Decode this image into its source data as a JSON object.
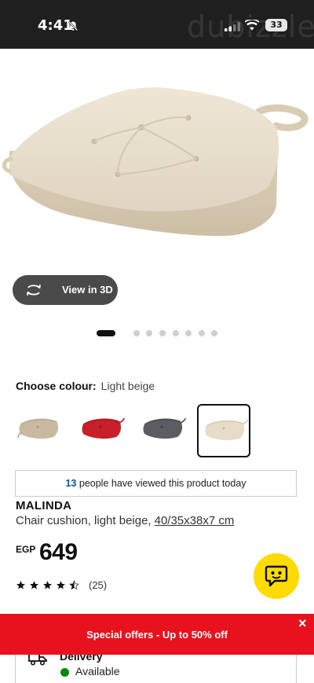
{
  "status_bar": {
    "time": "4:41",
    "battery": "33",
    "watermark": "dubizzle"
  },
  "product_gallery": {
    "view3d_label": "View in 3D",
    "image_count": 9,
    "active_index": 0
  },
  "colour": {
    "label": "Choose colour:",
    "selected": "Light beige",
    "swatches": [
      {
        "name": "beige-dark",
        "color": "#c9b9a0"
      },
      {
        "name": "red",
        "color": "#c8202a"
      },
      {
        "name": "dark-grey",
        "color": "#5b5d60"
      },
      {
        "name": "light-beige",
        "color": "#e6dcc8"
      }
    ]
  },
  "viewed": {
    "count": "13",
    "text": "people have viewed this product today"
  },
  "product": {
    "name": "MALINDA",
    "description": "Chair cushion, light beige,",
    "dimensions": "40/35x38x7 cm",
    "currency": "EGP",
    "price": "649",
    "rating": 4.5,
    "reviews": "(25)"
  },
  "offer_banner": {
    "text": "Special offers - Up to 50% off",
    "close": "×"
  },
  "delivery": {
    "title": "Delivery",
    "status": "Available"
  },
  "colors": {
    "status_bar": "#1f1f1f",
    "banner_red": "#e8111e",
    "chat_yellow": "#ffdb00",
    "link_blue": "#0058a3",
    "available_green": "#0a8a00"
  }
}
